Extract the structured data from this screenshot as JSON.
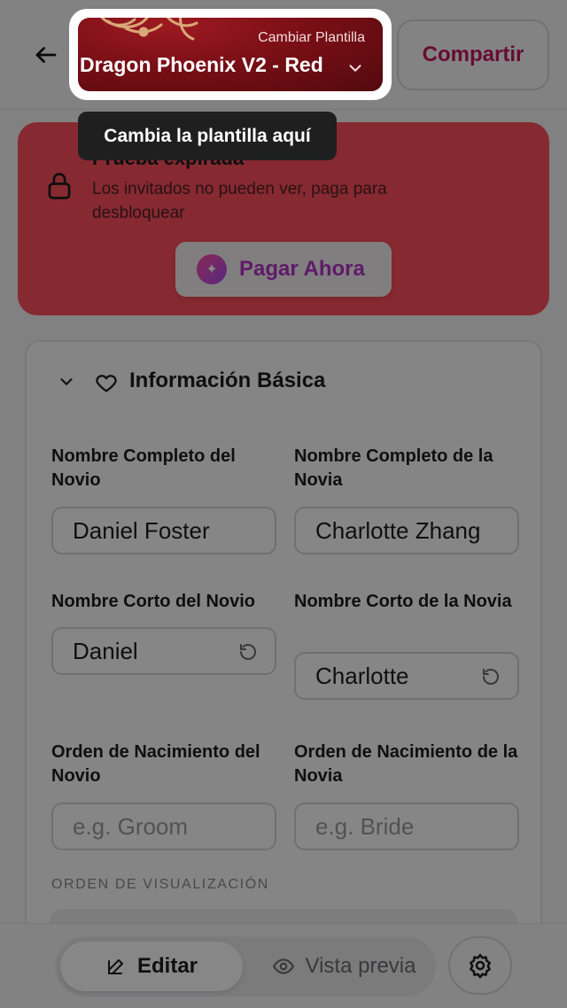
{
  "header": {
    "template_subtitle": "Cambiar Plantilla",
    "template_name": "Dragon Phoenix V2 - Red",
    "share_label": "Compartir"
  },
  "tooltip": {
    "text": "Cambia la plantilla aquí"
  },
  "alert": {
    "title": "Prueba expirada",
    "description": "Los invitados no pueden ver, paga para desbloquear",
    "pay_label": "Pagar Ahora",
    "color": "#ff4f5e"
  },
  "section": {
    "title": "Información Básica",
    "fields": {
      "groom_full_label": "Nombre Completo del Novio",
      "groom_full_value": "Daniel Foster",
      "bride_full_label": "Nombre Completo de la Novia",
      "bride_full_value": "Charlotte Zhang",
      "groom_short_label": "Nombre Corto del Novio",
      "groom_short_value": "Daniel",
      "bride_short_label": "Nombre Corto de la Novia",
      "bride_short_value": "Charlotte",
      "groom_order_label": "Orden de Nacimiento del Novio",
      "groom_order_placeholder": "e.g. Groom",
      "bride_order_label": "Orden de Nacimiento de la Novia",
      "bride_order_placeholder": "e.g. Bride"
    },
    "display_order_label": "ORDEN DE VISUALIZACIÓN"
  },
  "bottom_nav": {
    "edit_label": "Editar",
    "preview_label": "Vista previa",
    "active": "edit"
  },
  "icons": {
    "back": "arrow-left-icon",
    "lock": "lock-icon",
    "sparkle": "sparkle-icon",
    "chevron": "chevron-down-icon",
    "heart": "heart-icon",
    "reset": "reset-icon",
    "edit": "pencil-icon",
    "preview": "eye-icon",
    "settings": "gear-icon"
  },
  "colors": {
    "accent": "#c2185b",
    "pay": "#b233c4",
    "template": "#7a0f16"
  }
}
